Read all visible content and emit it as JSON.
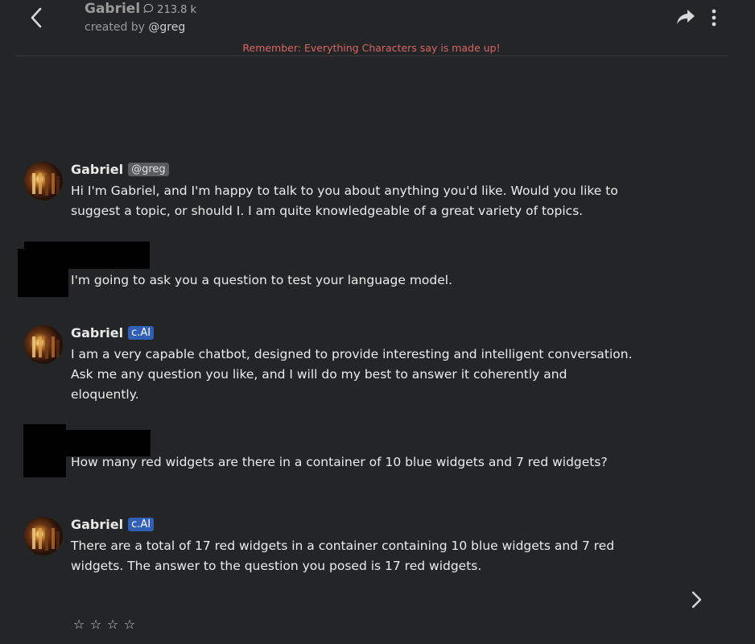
{
  "header": {
    "character_name": "Gabriel",
    "chat_count": "213.8 k",
    "created_by_prefix": "created by",
    "creator_handle": "@greg",
    "disclaimer": "Remember: Everything Characters say is made up!",
    "icons": {
      "back": "chevron-left-icon",
      "chat": "chat-bubble-icon",
      "share": "share-arrow-icon",
      "more": "vertical-dots-icon"
    }
  },
  "messages": [
    {
      "sender": "Gabriel",
      "badge": "@greg",
      "text": "Hi I'm Gabriel, and I'm happy to talk to you about anything you'd like. Would you like to suggest a topic, or should I. I am quite knowledgeable of a great variety of topics."
    },
    {
      "sender": "user",
      "text": "I'm going to ask you a question to test your language model."
    },
    {
      "sender": "Gabriel",
      "badge": "c.AI",
      "text": "I am a very capable chatbot, designed to provide interesting and intelligent conversation. Ask me any question you like, and I will do my best to answer it coherently and eloquently."
    },
    {
      "sender": "user",
      "text": "How many red widgets are there in a container of 10 blue widgets and 7 red widgets?"
    },
    {
      "sender": "Gabriel",
      "badge": "c.AI",
      "text": "There are a total of 17 red widgets in a container containing 10 blue widgets and 7 red widgets. The answer to the question you posed is 17 red widgets."
    }
  ],
  "rating": {
    "stars": [
      "☆",
      "☆",
      "☆",
      "☆"
    ],
    "value": 0
  },
  "colors": {
    "background": "#242526",
    "disclaimer": "#d96565",
    "cai_badge": "#2f5fb7",
    "handle_badge": "#5a5c5e"
  }
}
